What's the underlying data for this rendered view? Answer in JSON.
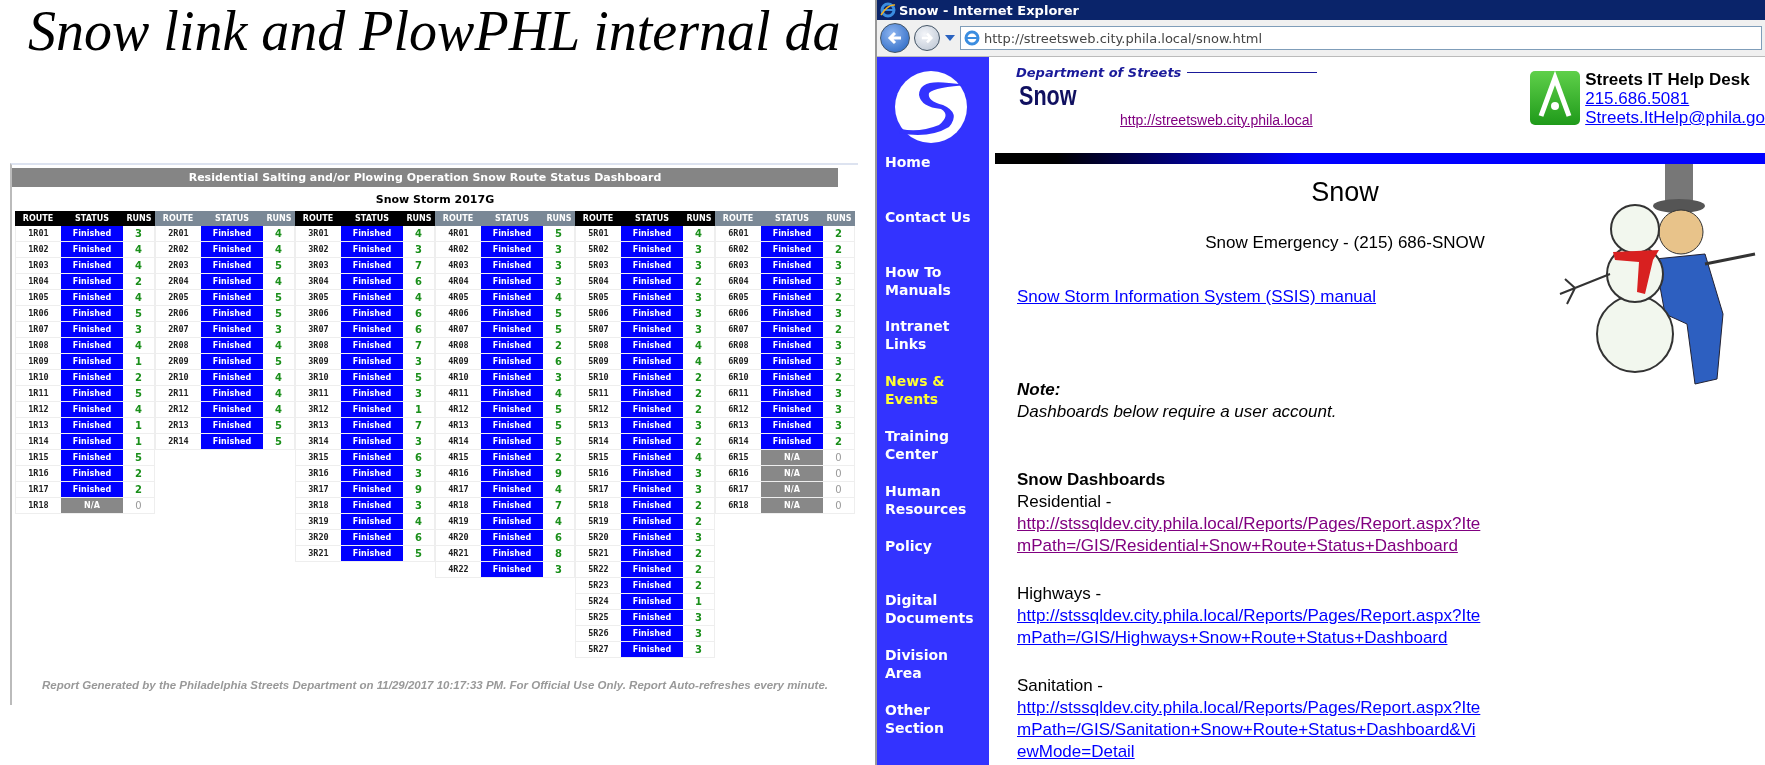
{
  "slide_title": "Snow link and PlowPHL internal da",
  "dashboard": {
    "title": "Residential Salting and/or Plowing Operation Snow Route Status Dashboard",
    "subtitle": "Snow Storm 2017G",
    "groups": [
      {
        "color": "#000000",
        "headers": [
          "ROUTE",
          "STATUS",
          "RUNS"
        ],
        "rows": [
          {
            "route": "1R01",
            "status": "Finished",
            "runs": "3",
            "kind": "finished"
          },
          {
            "route": "1R02",
            "status": "Finished",
            "runs": "4",
            "kind": "finished"
          },
          {
            "route": "1R03",
            "status": "Finished",
            "runs": "4",
            "kind": "finished"
          },
          {
            "route": "1R04",
            "status": "Finished",
            "runs": "2",
            "kind": "finished"
          },
          {
            "route": "1R05",
            "status": "Finished",
            "runs": "4",
            "kind": "finished"
          },
          {
            "route": "1R06",
            "status": "Finished",
            "runs": "5",
            "kind": "finished"
          },
          {
            "route": "1R07",
            "status": "Finished",
            "runs": "3",
            "kind": "finished"
          },
          {
            "route": "1R08",
            "status": "Finished",
            "runs": "4",
            "kind": "finished"
          },
          {
            "route": "1R09",
            "status": "Finished",
            "runs": "1",
            "kind": "finished"
          },
          {
            "route": "1R10",
            "status": "Finished",
            "runs": "2",
            "kind": "finished"
          },
          {
            "route": "1R11",
            "status": "Finished",
            "runs": "5",
            "kind": "finished"
          },
          {
            "route": "1R12",
            "status": "Finished",
            "runs": "4",
            "kind": "finished"
          },
          {
            "route": "1R13",
            "status": "Finished",
            "runs": "1",
            "kind": "finished"
          },
          {
            "route": "1R14",
            "status": "Finished",
            "runs": "1",
            "kind": "finished"
          },
          {
            "route": "1R15",
            "status": "Finished",
            "runs": "5",
            "kind": "finished"
          },
          {
            "route": "1R16",
            "status": "Finished",
            "runs": "2",
            "kind": "finished"
          },
          {
            "route": "1R17",
            "status": "Finished",
            "runs": "2",
            "kind": "finished"
          },
          {
            "route": "1R18",
            "status": "N/A",
            "runs": "0",
            "kind": "na"
          }
        ]
      },
      {
        "color": "#7a8896",
        "headers": [
          "ROUTE",
          "STATUS",
          "RUNS"
        ],
        "rows": [
          {
            "route": "2R01",
            "status": "Finished",
            "runs": "4",
            "kind": "finished"
          },
          {
            "route": "2R02",
            "status": "Finished",
            "runs": "4",
            "kind": "finished"
          },
          {
            "route": "2R03",
            "status": "Finished",
            "runs": "5",
            "kind": "finished"
          },
          {
            "route": "2R04",
            "status": "Finished",
            "runs": "4",
            "kind": "finished"
          },
          {
            "route": "2R05",
            "status": "Finished",
            "runs": "5",
            "kind": "finished"
          },
          {
            "route": "2R06",
            "status": "Finished",
            "runs": "5",
            "kind": "finished"
          },
          {
            "route": "2R07",
            "status": "Finished",
            "runs": "3",
            "kind": "finished"
          },
          {
            "route": "2R08",
            "status": "Finished",
            "runs": "4",
            "kind": "finished"
          },
          {
            "route": "2R09",
            "status": "Finished",
            "runs": "5",
            "kind": "finished"
          },
          {
            "route": "2R10",
            "status": "Finished",
            "runs": "4",
            "kind": "finished"
          },
          {
            "route": "2R11",
            "status": "Finished",
            "runs": "4",
            "kind": "finished"
          },
          {
            "route": "2R12",
            "status": "Finished",
            "runs": "4",
            "kind": "finished"
          },
          {
            "route": "2R13",
            "status": "Finished",
            "runs": "5",
            "kind": "finished"
          },
          {
            "route": "2R14",
            "status": "Finished",
            "runs": "5",
            "kind": "finished"
          }
        ]
      },
      {
        "color": "#000000",
        "headers": [
          "ROUTE",
          "STATUS",
          "RUNS"
        ],
        "rows": [
          {
            "route": "3R01",
            "status": "Finished",
            "runs": "4",
            "kind": "finished"
          },
          {
            "route": "3R02",
            "status": "Finished",
            "runs": "3",
            "kind": "finished"
          },
          {
            "route": "3R03",
            "status": "Finished",
            "runs": "7",
            "kind": "finished"
          },
          {
            "route": "3R04",
            "status": "Finished",
            "runs": "6",
            "kind": "finished"
          },
          {
            "route": "3R05",
            "status": "Finished",
            "runs": "4",
            "kind": "finished"
          },
          {
            "route": "3R06",
            "status": "Finished",
            "runs": "6",
            "kind": "finished"
          },
          {
            "route": "3R07",
            "status": "Finished",
            "runs": "6",
            "kind": "finished"
          },
          {
            "route": "3R08",
            "status": "Finished",
            "runs": "7",
            "kind": "finished"
          },
          {
            "route": "3R09",
            "status": "Finished",
            "runs": "3",
            "kind": "finished"
          },
          {
            "route": "3R10",
            "status": "Finished",
            "runs": "5",
            "kind": "finished"
          },
          {
            "route": "3R11",
            "status": "Finished",
            "runs": "3",
            "kind": "finished"
          },
          {
            "route": "3R12",
            "status": "Finished",
            "runs": "1",
            "kind": "finished"
          },
          {
            "route": "3R13",
            "status": "Finished",
            "runs": "7",
            "kind": "finished"
          },
          {
            "route": "3R14",
            "status": "Finished",
            "runs": "3",
            "kind": "finished"
          },
          {
            "route": "3R15",
            "status": "Finished",
            "runs": "6",
            "kind": "finished"
          },
          {
            "route": "3R16",
            "status": "Finished",
            "runs": "3",
            "kind": "finished"
          },
          {
            "route": "3R17",
            "status": "Finished",
            "runs": "9",
            "kind": "finished"
          },
          {
            "route": "3R18",
            "status": "Finished",
            "runs": "3",
            "kind": "finished"
          },
          {
            "route": "3R19",
            "status": "Finished",
            "runs": "4",
            "kind": "finished"
          },
          {
            "route": "3R20",
            "status": "Finished",
            "runs": "6",
            "kind": "finished"
          },
          {
            "route": "3R21",
            "status": "Finished",
            "runs": "5",
            "kind": "finished"
          }
        ]
      },
      {
        "color": "#7a8896",
        "headers": [
          "ROUTE",
          "STATUS",
          "RUNS"
        ],
        "rows": [
          {
            "route": "4R01",
            "status": "Finished",
            "runs": "5",
            "kind": "finished"
          },
          {
            "route": "4R02",
            "status": "Finished",
            "runs": "3",
            "kind": "finished"
          },
          {
            "route": "4R03",
            "status": "Finished",
            "runs": "3",
            "kind": "finished"
          },
          {
            "route": "4R04",
            "status": "Finished",
            "runs": "3",
            "kind": "finished"
          },
          {
            "route": "4R05",
            "status": "Finished",
            "runs": "4",
            "kind": "finished"
          },
          {
            "route": "4R06",
            "status": "Finished",
            "runs": "5",
            "kind": "finished"
          },
          {
            "route": "4R07",
            "status": "Finished",
            "runs": "5",
            "kind": "finished"
          },
          {
            "route": "4R08",
            "status": "Finished",
            "runs": "2",
            "kind": "finished"
          },
          {
            "route": "4R09",
            "status": "Finished",
            "runs": "6",
            "kind": "finished"
          },
          {
            "route": "4R10",
            "status": "Finished",
            "runs": "3",
            "kind": "finished"
          },
          {
            "route": "4R11",
            "status": "Finished",
            "runs": "4",
            "kind": "finished"
          },
          {
            "route": "4R12",
            "status": "Finished",
            "runs": "5",
            "kind": "finished"
          },
          {
            "route": "4R13",
            "status": "Finished",
            "runs": "5",
            "kind": "finished"
          },
          {
            "route": "4R14",
            "status": "Finished",
            "runs": "5",
            "kind": "finished"
          },
          {
            "route": "4R15",
            "status": "Finished",
            "runs": "2",
            "kind": "finished"
          },
          {
            "route": "4R16",
            "status": "Finished",
            "runs": "9",
            "kind": "finished"
          },
          {
            "route": "4R17",
            "status": "Finished",
            "runs": "4",
            "kind": "finished"
          },
          {
            "route": "4R18",
            "status": "Finished",
            "runs": "7",
            "kind": "finished"
          },
          {
            "route": "4R19",
            "status": "Finished",
            "runs": "4",
            "kind": "finished"
          },
          {
            "route": "4R20",
            "status": "Finished",
            "runs": "6",
            "kind": "finished"
          },
          {
            "route": "4R21",
            "status": "Finished",
            "runs": "8",
            "kind": "finished"
          },
          {
            "route": "4R22",
            "status": "Finished",
            "runs": "3",
            "kind": "finished"
          }
        ]
      },
      {
        "color": "#000000",
        "headers": [
          "ROUTE",
          "STATUS",
          "RUNS"
        ],
        "rows": [
          {
            "route": "5R01",
            "status": "Finished",
            "runs": "4",
            "kind": "finished"
          },
          {
            "route": "5R02",
            "status": "Finished",
            "runs": "3",
            "kind": "finished"
          },
          {
            "route": "5R03",
            "status": "Finished",
            "runs": "3",
            "kind": "finished"
          },
          {
            "route": "5R04",
            "status": "Finished",
            "runs": "2",
            "kind": "finished"
          },
          {
            "route": "5R05",
            "status": "Finished",
            "runs": "3",
            "kind": "finished"
          },
          {
            "route": "5R06",
            "status": "Finished",
            "runs": "3",
            "kind": "finished"
          },
          {
            "route": "5R07",
            "status": "Finished",
            "runs": "3",
            "kind": "finished"
          },
          {
            "route": "5R08",
            "status": "Finished",
            "runs": "4",
            "kind": "finished"
          },
          {
            "route": "5R09",
            "status": "Finished",
            "runs": "4",
            "kind": "finished"
          },
          {
            "route": "5R10",
            "status": "Finished",
            "runs": "2",
            "kind": "finished"
          },
          {
            "route": "5R11",
            "status": "Finished",
            "runs": "2",
            "kind": "finished"
          },
          {
            "route": "5R12",
            "status": "Finished",
            "runs": "2",
            "kind": "finished"
          },
          {
            "route": "5R13",
            "status": "Finished",
            "runs": "3",
            "kind": "finished"
          },
          {
            "route": "5R14",
            "status": "Finished",
            "runs": "2",
            "kind": "finished"
          },
          {
            "route": "5R15",
            "status": "Finished",
            "runs": "4",
            "kind": "finished"
          },
          {
            "route": "5R16",
            "status": "Finished",
            "runs": "3",
            "kind": "finished"
          },
          {
            "route": "5R17",
            "status": "Finished",
            "runs": "3",
            "kind": "finished"
          },
          {
            "route": "5R18",
            "status": "Finished",
            "runs": "2",
            "kind": "finished"
          },
          {
            "route": "5R19",
            "status": "Finished",
            "runs": "2",
            "kind": "finished"
          },
          {
            "route": "5R20",
            "status": "Finished",
            "runs": "3",
            "kind": "finished"
          },
          {
            "route": "5R21",
            "status": "Finished",
            "runs": "2",
            "kind": "finished"
          },
          {
            "route": "5R22",
            "status": "Finished",
            "runs": "2",
            "kind": "finished"
          },
          {
            "route": "5R23",
            "status": "Finished",
            "runs": "2",
            "kind": "finished"
          },
          {
            "route": "5R24",
            "status": "Finished",
            "runs": "1",
            "kind": "finished"
          },
          {
            "route": "5R25",
            "status": "Finished",
            "runs": "3",
            "kind": "finished"
          },
          {
            "route": "5R26",
            "status": "Finished",
            "runs": "3",
            "kind": "finished"
          },
          {
            "route": "5R27",
            "status": "Finished",
            "runs": "3",
            "kind": "finished"
          }
        ]
      },
      {
        "color": "#7a8896",
        "headers": [
          "ROUTE",
          "STATUS",
          "RUNS"
        ],
        "rows": [
          {
            "route": "6R01",
            "status": "Finished",
            "runs": "2",
            "kind": "finished"
          },
          {
            "route": "6R02",
            "status": "Finished",
            "runs": "2",
            "kind": "finished"
          },
          {
            "route": "6R03",
            "status": "Finished",
            "runs": "3",
            "kind": "finished"
          },
          {
            "route": "6R04",
            "status": "Finished",
            "runs": "3",
            "kind": "finished"
          },
          {
            "route": "6R05",
            "status": "Finished",
            "runs": "2",
            "kind": "finished"
          },
          {
            "route": "6R06",
            "status": "Finished",
            "runs": "3",
            "kind": "finished"
          },
          {
            "route": "6R07",
            "status": "Finished",
            "runs": "2",
            "kind": "finished"
          },
          {
            "route": "6R08",
            "status": "Finished",
            "runs": "3",
            "kind": "finished"
          },
          {
            "route": "6R09",
            "status": "Finished",
            "runs": "3",
            "kind": "finished"
          },
          {
            "route": "6R10",
            "status": "Finished",
            "runs": "2",
            "kind": "finished"
          },
          {
            "route": "6R11",
            "status": "Finished",
            "runs": "3",
            "kind": "finished"
          },
          {
            "route": "6R12",
            "status": "Finished",
            "runs": "3",
            "kind": "finished"
          },
          {
            "route": "6R13",
            "status": "Finished",
            "runs": "3",
            "kind": "finished"
          },
          {
            "route": "6R14",
            "status": "Finished",
            "runs": "2",
            "kind": "finished"
          },
          {
            "route": "6R15",
            "status": "N/A",
            "runs": "0",
            "kind": "na"
          },
          {
            "route": "6R16",
            "status": "N/A",
            "runs": "0",
            "kind": "na"
          },
          {
            "route": "6R17",
            "status": "N/A",
            "runs": "0",
            "kind": "na"
          },
          {
            "route": "6R18",
            "status": "N/A",
            "runs": "0",
            "kind": "na"
          }
        ]
      }
    ],
    "footer": "Report Generated by the Philadelphia Streets Department on 11/29/2017 10:17:33 PM. For Official Use Only. Report Auto-refreshes every minute."
  },
  "browser": {
    "title": "Snow - Internet Explorer",
    "address": "http://streetsweb.city.phila.local/snow.html",
    "nav": [
      {
        "label": "Home",
        "selected": false
      },
      {
        "label": "Contact Us",
        "selected": false
      },
      {
        "label": "How To Manuals",
        "selected": false
      },
      {
        "label": "Intranet Links",
        "selected": false
      },
      {
        "label": "News & Events",
        "selected": true
      },
      {
        "label": "Training Center",
        "selected": false
      },
      {
        "label": "Human Resources",
        "selected": false
      },
      {
        "label": "Policy",
        "selected": false
      },
      {
        "label": "Digital Documents",
        "selected": false
      },
      {
        "label": "Division Area",
        "selected": false
      },
      {
        "label": "Other Section",
        "selected": false
      }
    ],
    "header": {
      "department": "Department of Streets",
      "site_name": "Snow",
      "site_link": {
        "text": "http://streetsweb.city.phila.local",
        "visited": true
      },
      "help_desk": {
        "title": "Streets IT Help Desk",
        "phone": "215.686.5081",
        "email": "Streets.ItHelp@phila.go"
      }
    },
    "content": {
      "heading": "Snow",
      "emergency": "Snow Emergency - (215) 686-SNOW",
      "manual_link": {
        "text": "Snow Storm Information System (SSIS) manual",
        "visited": false
      },
      "note_label": "Note:",
      "note": "Dashboards below require a user account.",
      "dashboards_heading": "Snow Dashboards",
      "dashboards": [
        {
          "label": "Residential -",
          "link": "http://stssqldev.city.phila.local/Reports/Pages/Report.aspx?ItemPath=/GIS/Residential+Snow+Route+Status+Dashboard",
          "visited": true
        },
        {
          "label": "Highways -",
          "link": "http://stssqldev.city.phila.local/Reports/Pages/Report.aspx?ItemPath=/GIS/Highways+Snow+Route+Status+Dashboard",
          "visited": false
        },
        {
          "label": "Sanitation -",
          "link": "http://stssqldev.city.phila.local/Reports/Pages/Report.aspx?ItemPath=/GIS/Sanitation+Snow+Route+Status+Dashboard&ViewMode=Detail",
          "visited": false
        }
      ]
    }
  }
}
